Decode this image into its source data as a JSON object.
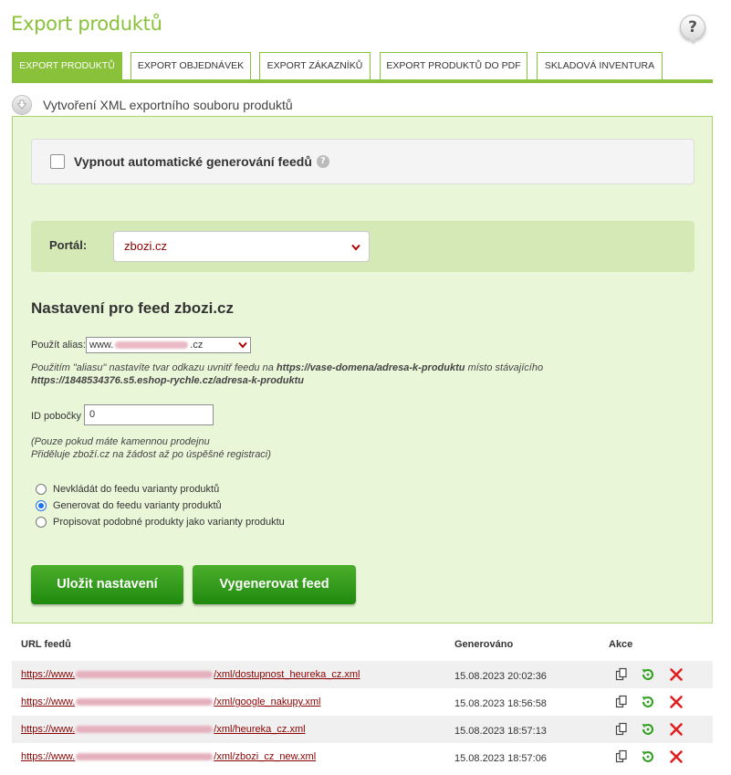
{
  "page": {
    "title": "Export produktů",
    "help_symbol": "?"
  },
  "tabs": [
    {
      "label": "EXPORT PRODUKTŮ",
      "active": true
    },
    {
      "label": "EXPORT OBJEDNÁVEK",
      "active": false
    },
    {
      "label": "EXPORT ZÁKAZNÍKŮ",
      "active": false
    },
    {
      "label": "EXPORT PRODUKTŮ DO PDF",
      "active": false
    },
    {
      "label": "SKLADOVÁ INVENTURA",
      "active": false
    }
  ],
  "section": {
    "title": "Vytvoření XML exportního souboru produktů"
  },
  "auto_feed": {
    "label": "Vypnout automatické generování feedů",
    "checked": false,
    "info_symbol": "?"
  },
  "portal": {
    "label": "Portál:",
    "selected": "zbozi.cz"
  },
  "feed_settings": {
    "title": "Nastavení pro feed zbozi.cz",
    "alias_label": "Použít alias:",
    "alias_prefix": "www.",
    "alias_suffix": ".cz",
    "alias_note_1": "Použitím \"aliasu\" nastavíte tvar odkazu uvnitř feedu na",
    "alias_note_url1": "https://vase-domena/adresa-k-produktu",
    "alias_note_2": "místo stávajícího",
    "alias_note_url2": "https://1848534376.s5.eshop-rychle.cz/adresa-k-produktu",
    "branch_label": "ID pobočky",
    "branch_value": "0",
    "branch_note_1": "(Pouze pokud máte kamennou prodejnu",
    "branch_note_2": "Přiděluje zboží.cz na žádost až po úspěšné registraci)",
    "variant_options": [
      {
        "label": "Nevkládát do feedu varianty produktů",
        "checked": false
      },
      {
        "label": "Generovat do feedu varianty produktů",
        "checked": true
      },
      {
        "label": "Propisovat podobné produkty jako varianty produktu",
        "checked": false
      }
    ],
    "save_label": "Uložit nastavení",
    "generate_label": "Vygenerovat feed"
  },
  "feeds": {
    "col_url": "URL feedů",
    "col_generated": "Generováno",
    "col_actions": "Akce",
    "rows": [
      {
        "url_prefix": "https://www.",
        "url_suffix": "/xml/dostupnost_heureka_cz.xml",
        "generated": "15.08.2023 20:02:36"
      },
      {
        "url_prefix": "https://www.",
        "url_suffix": "/xml/google_nakupy.xml",
        "generated": "15.08.2023 18:56:58"
      },
      {
        "url_prefix": "https://www.",
        "url_suffix": "/xml/heureka_cz.xml",
        "generated": "15.08.2023 18:57:13"
      },
      {
        "url_prefix": "https://www.",
        "url_suffix": "/xml/zbozi_cz_new.xml",
        "generated": "15.08.2023 18:57:06"
      }
    ]
  },
  "colors": {
    "accent_green": "#8ac13a",
    "panel_bg": "#eaf6d8",
    "button_green": "#1f8a0e",
    "link_red": "#8b0000",
    "delete_red": "#e02020"
  }
}
